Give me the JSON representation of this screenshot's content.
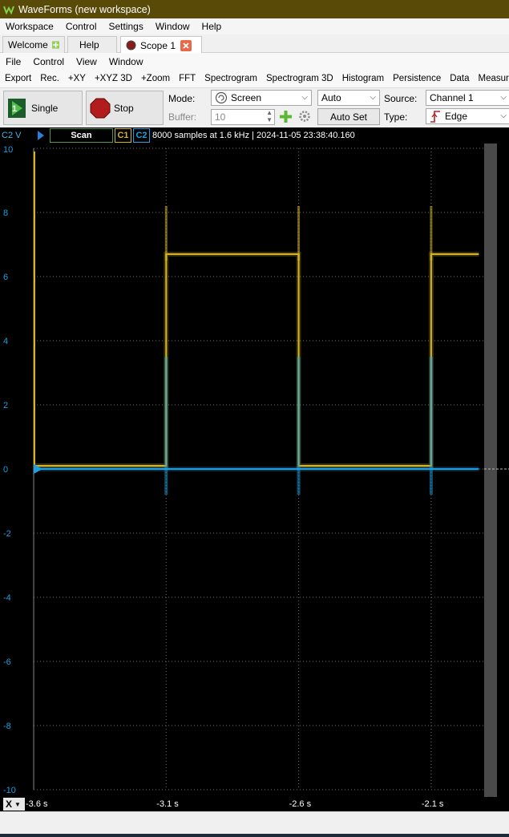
{
  "window": {
    "title": "WaveForms (new workspace)"
  },
  "menu_main": [
    "Workspace",
    "Control",
    "Settings",
    "Window",
    "Help"
  ],
  "tabs": [
    {
      "label": "Welcome"
    },
    {
      "label": "Help"
    },
    {
      "label": "Scope 1"
    }
  ],
  "menu_scope": [
    "File",
    "Control",
    "View",
    "Window"
  ],
  "toolbar": [
    "Export",
    "Rec.",
    "+XY",
    "+XYZ 3D",
    "+Zoom",
    "FFT",
    "Spectrogram",
    "Spectrogram 3D",
    "Histogram",
    "Persistence",
    "Data",
    "Measuren"
  ],
  "acq": {
    "single_label": "Single",
    "stop_label": "Stop",
    "mode_label": "Mode:",
    "mode_value": "Screen",
    "buffer_label": "Buffer:",
    "buffer_value": "10",
    "trigger_mode_value": "Auto",
    "autoset_label": "Auto Set",
    "source_label": "Source:",
    "source_value": "Channel 1",
    "type_label": "Type:",
    "type_value": "Edge"
  },
  "info": {
    "axis_channel": "C2 V",
    "scan_label": "Scan",
    "c1_label": "C1",
    "c2_label": "C2",
    "status": "8000 samples at 1.6 kHz | 2024-11-05 23:38:40.160"
  },
  "colors": {
    "c1": "#d4b526",
    "c2": "#1e9fe0",
    "grid": "#6a6a6a",
    "title_bar": "#5a4a08"
  },
  "chart_data": {
    "type": "line",
    "y_ticks": [
      "10",
      "8",
      "6",
      "4",
      "2",
      "0",
      "-2",
      "-4",
      "-6",
      "-8",
      "-10"
    ],
    "ylim": [
      -10,
      10
    ],
    "x_ticks": [
      "-3.6 s",
      "-3.1 s",
      "-2.6 s",
      "-2.1 s"
    ],
    "xlim": [
      -3.6,
      -1.9
    ],
    "x_axis_label": "X",
    "series": [
      {
        "name": "C1",
        "points": [
          [
            -3.6,
            0.1
          ],
          [
            -3.1,
            0.1
          ],
          [
            -3.1,
            6.7
          ],
          [
            -2.6,
            6.7
          ],
          [
            -2.6,
            0.1
          ],
          [
            -2.1,
            0.1
          ],
          [
            -2.1,
            6.7
          ],
          [
            -1.92,
            6.7
          ]
        ]
      },
      {
        "name": "C2",
        "points": [
          [
            -3.6,
            0.0
          ],
          [
            -1.92,
            0.0
          ]
        ]
      }
    ]
  }
}
